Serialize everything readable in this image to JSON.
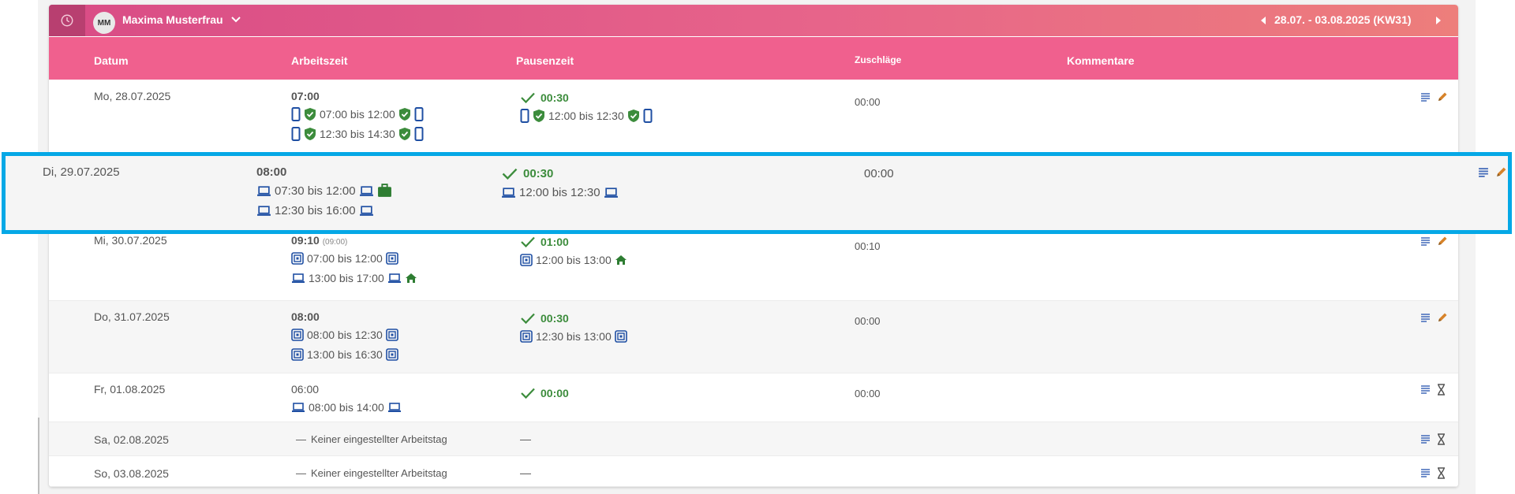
{
  "user": {
    "initials": "MM",
    "name": "Maxima Musterfrau"
  },
  "week": {
    "label": "28.07. - 03.08.2025 (KW31)"
  },
  "columns": {
    "date": "Datum",
    "work": "Arbeitszeit",
    "pause": "Pausenzeit",
    "surcharge": "Zuschläge",
    "comments": "Kommentare"
  },
  "rows": [
    {
      "date": "Mo, 28.07.2025",
      "work_total": "07:00",
      "segments": [
        "07:00 bis 12:00",
        "12:30 bis 14:30"
      ],
      "pause_total": "00:30",
      "pause_segment": "12:00 bis 12:30",
      "surcharge": "00:00"
    },
    {
      "date": "Di, 29.07.2025",
      "work_total": "08:00",
      "segments": [
        "07:30 bis 12:00",
        "12:30 bis 16:00"
      ],
      "pause_total": "00:30",
      "pause_segment": "12:00 bis 12:30",
      "surcharge": "00:00"
    },
    {
      "date": "Mi, 30.07.2025",
      "work_total": "09:10",
      "work_total_note": "(09:00)",
      "segments": [
        "07:00 bis 12:00",
        "13:00 bis 17:00"
      ],
      "pause_total": "01:00",
      "pause_segment": "12:00 bis 13:00",
      "surcharge": "00:10"
    },
    {
      "date": "Do, 31.07.2025",
      "work_total": "08:00",
      "segments": [
        "08:00 bis 12:30",
        "13:00 bis 16:30"
      ],
      "pause_total": "00:30",
      "pause_segment": "12:30 bis 13:00",
      "surcharge": "00:00"
    },
    {
      "date": "Fr, 01.08.2025",
      "work_total": "06:00",
      "segments": [
        "08:00 bis 14:00"
      ],
      "pause_total": "00:00",
      "surcharge": "00:00"
    },
    {
      "date": "Sa, 02.08.2025",
      "off_text": "Keiner eingestellter Arbeitstag",
      "pause_dash": "—",
      "work_dash": "—"
    },
    {
      "date": "So, 03.08.2025",
      "off_text": "Keiner eingestellter Arbeitstag",
      "pause_dash": "—",
      "work_dash": "—"
    }
  ],
  "colors": {
    "accent": "#f0608e",
    "topbar": "#e7648a",
    "confirmed": "#3c8c3c",
    "device": "#1f4fa3",
    "highlight": "#05a8e6",
    "edit": "#d7832a"
  },
  "icons": [
    "clock-icon",
    "chevron-down-icon",
    "caret-left-icon",
    "caret-right-icon",
    "smartphone-icon",
    "shield-check-icon",
    "laptop-icon",
    "briefcase-icon",
    "nfc-terminal-icon",
    "home-icon",
    "checkmark-icon",
    "notes-icon",
    "pencil-icon",
    "hourglass-icon"
  ]
}
